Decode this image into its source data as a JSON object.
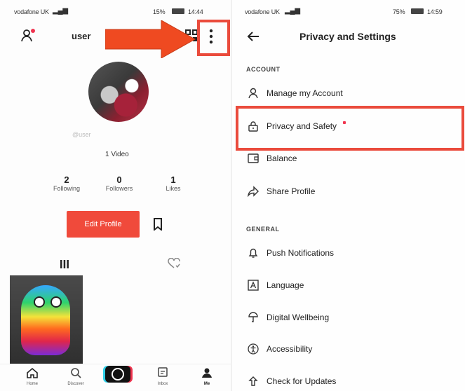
{
  "left_screen": {
    "status_bar": {
      "carrier": "vodafone UK",
      "battery": "15%",
      "time": "14:44"
    },
    "header": {
      "username": "user"
    },
    "profile": {
      "handle": "@user",
      "video_count": "1 Video",
      "stats": [
        {
          "num": "2",
          "label": "Following"
        },
        {
          "num": "0",
          "label": "Followers"
        },
        {
          "num": "1",
          "label": "Likes"
        }
      ],
      "edit_button": "Edit Profile"
    },
    "bottom_nav": [
      {
        "label": "Home",
        "icon": "home-icon"
      },
      {
        "label": "Discover",
        "icon": "search-icon"
      },
      {
        "label": "",
        "icon": "camera-icon"
      },
      {
        "label": "Inbox",
        "icon": "inbox-icon"
      },
      {
        "label": "Me",
        "icon": "person-icon"
      }
    ]
  },
  "right_screen": {
    "status_bar": {
      "carrier": "vodafone UK",
      "battery": "75%",
      "time": "14:59"
    },
    "header": {
      "title": "Privacy and Settings"
    },
    "sections": [
      {
        "title": "ACCOUNT",
        "items": [
          {
            "label": "Manage my Account",
            "icon": "person-outline-icon"
          },
          {
            "label": "Privacy and Safety",
            "icon": "lock-icon",
            "badge": true
          },
          {
            "label": "Balance",
            "icon": "wallet-icon"
          },
          {
            "label": "Share Profile",
            "icon": "share-icon"
          }
        ]
      },
      {
        "title": "GENERAL",
        "items": [
          {
            "label": "Push Notifications",
            "icon": "bell-icon"
          },
          {
            "label": "Language",
            "icon": "language-icon"
          },
          {
            "label": "Digital Wellbeing",
            "icon": "wellbeing-icon"
          },
          {
            "label": "Accessibility",
            "icon": "accessibility-icon"
          },
          {
            "label": "Check for Updates",
            "icon": "update-icon"
          }
        ]
      }
    ]
  },
  "colors": {
    "accent": "#f04a3b",
    "highlight": "#ea4b3c",
    "arrow": "#ef4a21"
  }
}
